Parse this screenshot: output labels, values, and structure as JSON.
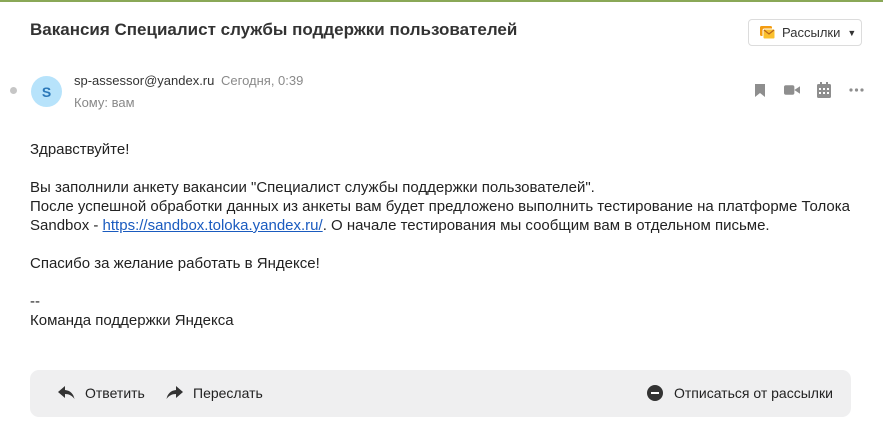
{
  "message": {
    "subject": "Вакансия Специалист службы поддержки пользователей",
    "sender_email": "sp-assessor@yandex.ru",
    "time": "Сегодня, 0:39",
    "to_line": "Кому: вам",
    "avatar_letter": "S",
    "body": {
      "greeting": "Здравствуйте!",
      "line1": "Вы заполнили анкету вакансии \"Специалист службы поддержки пользователей\".",
      "line2": "После успешной обработки данных из анкеты вам будет предложено выполнить тестирование на платформе Толока",
      "line3_prefix": "Sandbox - ",
      "link": "https://sandbox.toloka.yandex.ru/",
      "line3_suffix": ". О начале тестирования мы сообщим вам в отдельном письме.",
      "thanks": "Спасибо за желание работать в Яндексе!",
      "sig_dash": "--",
      "signature": "Команда поддержки Яндекса"
    }
  },
  "header": {
    "mailing_label": "Рассылки"
  },
  "toolbar": {
    "reply_label": "Ответить",
    "forward_label": "Переслать",
    "unsubscribe_label": "Отписаться от рассылки"
  },
  "icons": {
    "mailing": "mailing-icon",
    "bookmark": "bookmark-icon",
    "video": "video-camera-icon",
    "calendar": "calendar-icon",
    "more": "more-dots-icon",
    "reply": "reply-arrow-icon",
    "forward": "forward-arrow-icon",
    "unsubscribe": "minus-circle-icon"
  },
  "colors": {
    "accent_line": "#8aa857",
    "avatar_bg": "#b7e3fb",
    "avatar_text": "#2a77b8",
    "link": "#1a5bbf",
    "mailing_icon": "#f39c12",
    "toolbar_bg": "#efeff0"
  }
}
